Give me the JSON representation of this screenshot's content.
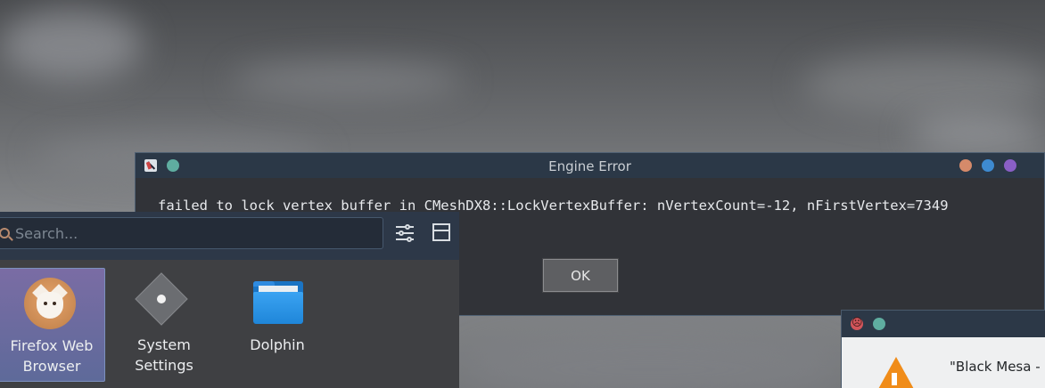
{
  "engine_error_dialog": {
    "title": "Engine Error",
    "message": "failed to lock vertex buffer in CMeshDX8::LockVertexBuffer: nVertexCount=-12, nFirstVertex=7349",
    "ok_label": "OK"
  },
  "launcher": {
    "search_placeholder": "Search...",
    "apps": [
      {
        "label_line1": "Firefox Web",
        "label_line2": "Browser",
        "icon": "firefox-icon"
      },
      {
        "label_line1": "System",
        "label_line2": "Settings",
        "icon": "settings-icon"
      },
      {
        "label_line1": "Dolphin",
        "label_line2": "",
        "icon": "folder-icon"
      }
    ]
  },
  "secondary_dialog": {
    "text": "\"Black Mesa - C",
    "icon": "warning-icon"
  },
  "colors": {
    "titlebar": "#2b3847",
    "selection": "#7a6ca4",
    "minimize": "#d58a6a",
    "maximize": "#3e8ad0",
    "close": "#8a5fc6",
    "pin": "#5fada0",
    "warning": "#f08c19"
  }
}
